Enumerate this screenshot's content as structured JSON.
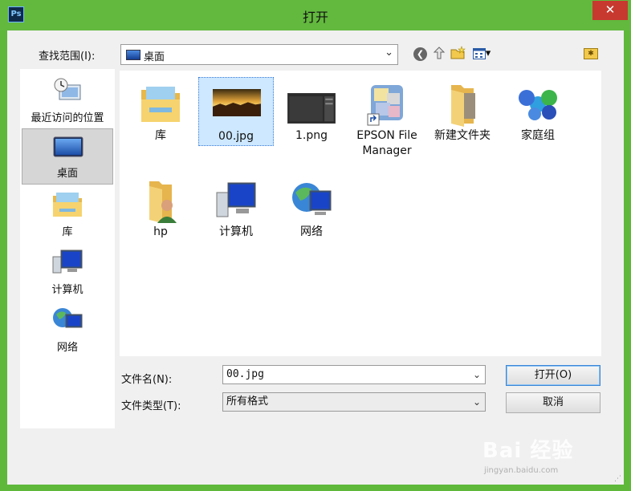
{
  "window": {
    "title": "打开",
    "app_icon_text": "Ps",
    "close_symbol": "✕"
  },
  "look_in": {
    "label": "查找范围(I):",
    "value": "桌面"
  },
  "toolbar": {
    "back_symbol": "❮",
    "view_arrow": "▾"
  },
  "places": [
    {
      "label": "最近访问的位置",
      "icon": "recent-places-icon",
      "selected": false
    },
    {
      "label": "桌面",
      "icon": "desktop-icon",
      "selected": true
    },
    {
      "label": "库",
      "icon": "libraries-icon",
      "selected": false
    },
    {
      "label": "计算机",
      "icon": "computer-icon",
      "selected": false
    },
    {
      "label": "网络",
      "icon": "network-icon",
      "selected": false
    }
  ],
  "files": [
    {
      "label": "库",
      "icon": "libraries-icon",
      "selected": false
    },
    {
      "label": "00.jpg",
      "icon": "image-thumbnail-icon",
      "selected": true
    },
    {
      "label": "1.png",
      "icon": "screenshot-thumbnail-icon",
      "selected": false
    },
    {
      "label": "EPSON File Manager",
      "icon": "epson-shortcut-icon",
      "selected": false
    },
    {
      "label": "新建文件夹",
      "icon": "folder-icon",
      "selected": false
    },
    {
      "label": "家庭组",
      "icon": "homegroup-icon",
      "selected": false
    },
    {
      "label": "hp",
      "icon": "user-folder-icon",
      "selected": false
    },
    {
      "label": "计算机",
      "icon": "computer-icon",
      "selected": false
    },
    {
      "label": "网络",
      "icon": "network-icon",
      "selected": false
    }
  ],
  "filename": {
    "label": "文件名(N):",
    "value": "00.jpg"
  },
  "filetype": {
    "label": "文件类型(T):",
    "value": "所有格式"
  },
  "buttons": {
    "open": "打开(O)",
    "cancel": "取消"
  },
  "watermark": {
    "logo": "Bai 经验",
    "url": "jingyan.baidu.com"
  },
  "colors": {
    "frame": "#62b93e",
    "close": "#c7392f",
    "selection": "#cde8ff"
  }
}
